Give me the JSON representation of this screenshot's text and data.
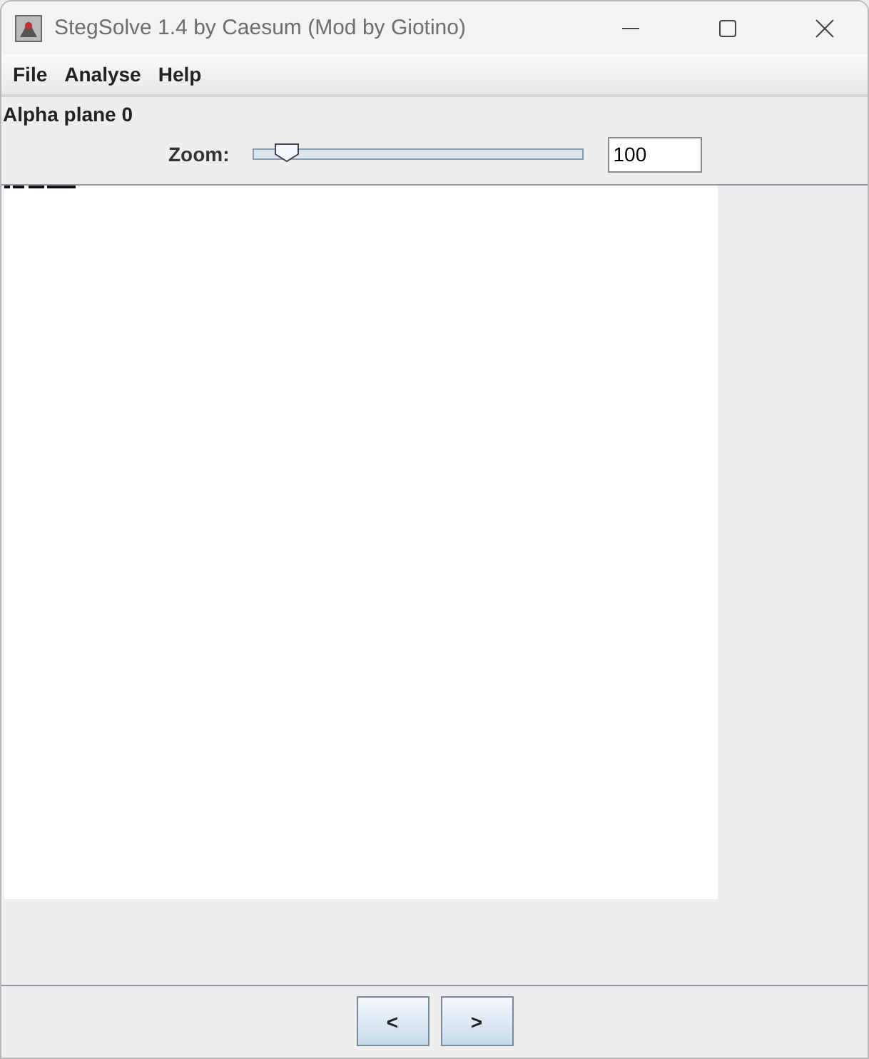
{
  "window": {
    "title": "StegSolve 1.4 by Caesum (Mod by Giotino)"
  },
  "menu": [
    {
      "label": "File"
    },
    {
      "label": "Analyse"
    },
    {
      "label": "Help"
    }
  ],
  "plane_label": "Alpha plane 0",
  "zoom": {
    "label": "Zoom:",
    "level": 0.1,
    "value": "100"
  },
  "buttons": [
    {
      "label": "<"
    },
    {
      "label": ">"
    }
  ]
}
